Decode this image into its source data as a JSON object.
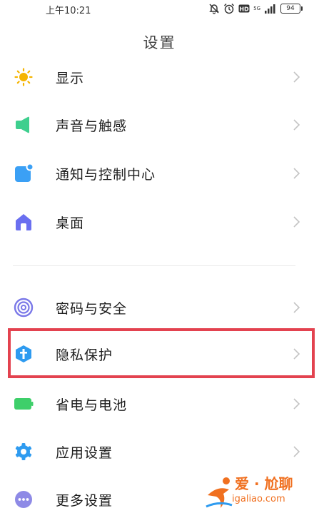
{
  "status_bar": {
    "time": "上午10:21",
    "network": "5G",
    "battery": "94"
  },
  "page": {
    "title": "设置"
  },
  "settings": [
    {
      "label": "显示",
      "icon": "sun-icon",
      "color": "#f5b400"
    },
    {
      "label": "声音与触感",
      "icon": "speaker-icon",
      "color": "#3ecf8e"
    },
    {
      "label": "通知与控制中心",
      "icon": "notification-icon",
      "color": "#3ba0f5"
    },
    {
      "label": "桌面",
      "icon": "home-icon",
      "color": "#6a6ff0"
    },
    {
      "label": "密码与安全",
      "icon": "fingerprint-icon",
      "color": "#7a78e8"
    },
    {
      "label": "隐私保护",
      "icon": "privacy-shield-icon",
      "color": "#2e9bf0"
    },
    {
      "label": "省电与电池",
      "icon": "battery-icon",
      "color": "#3ecf6a"
    },
    {
      "label": "应用设置",
      "icon": "gear-icon",
      "color": "#2e9bf0"
    },
    {
      "label": "更多设置",
      "icon": "more-icon",
      "color": "#8e8ae6"
    }
  ],
  "highlighted_item": "隐私保护",
  "watermark": {
    "brand": "爱 · 尬聊",
    "url": "igaliao.com",
    "color": "#f07020"
  }
}
